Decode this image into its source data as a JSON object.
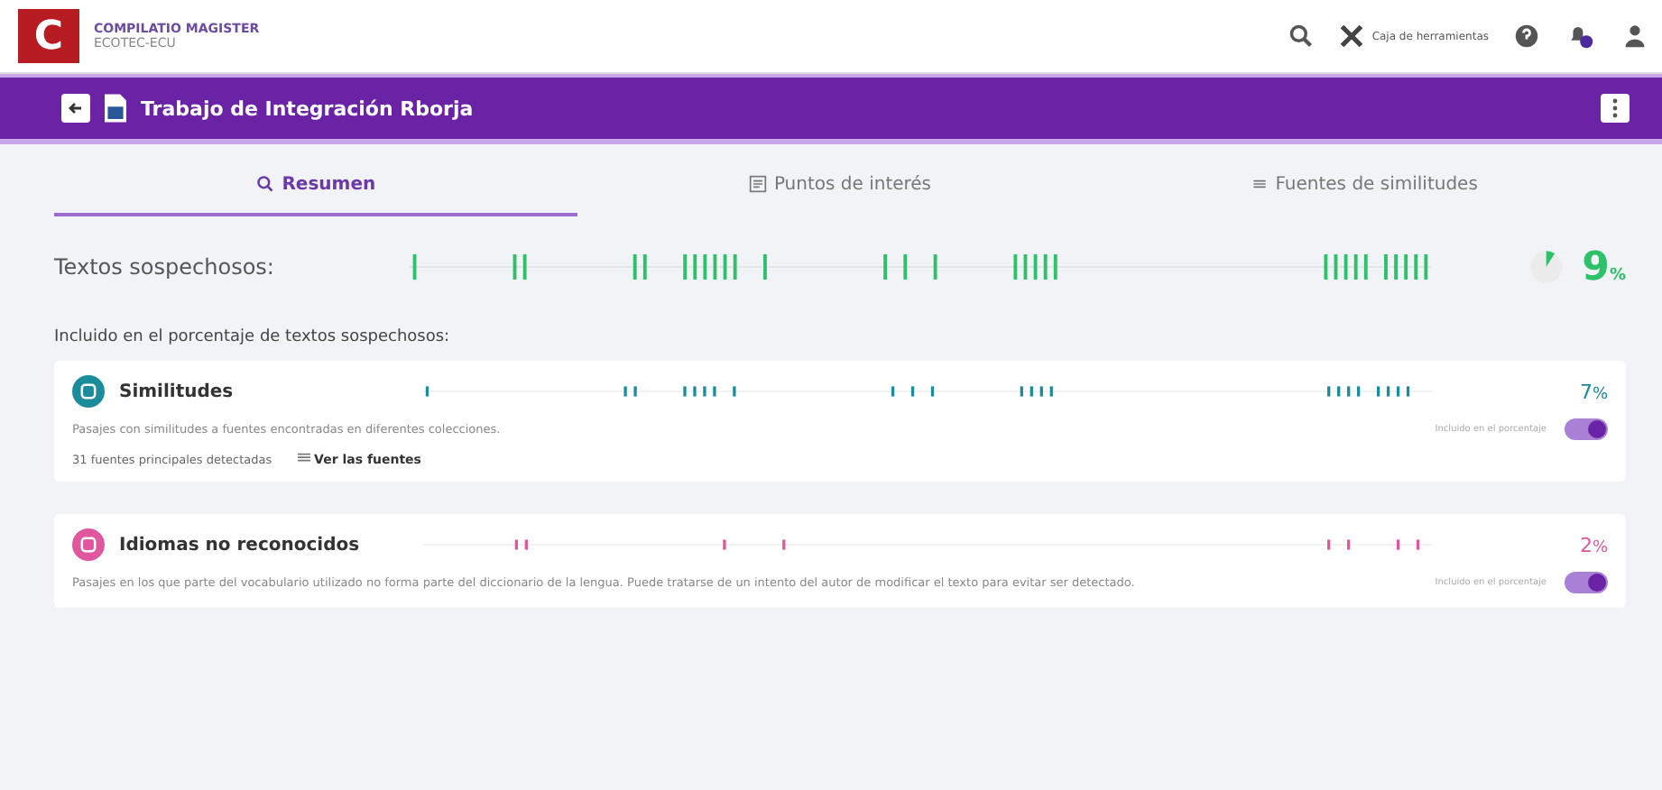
{
  "header": {
    "logo": "C",
    "brand": "COMPILATIO MAGISTER",
    "org": "ECOTEC-ECU",
    "toolbox": "Caja de herramientas"
  },
  "document": {
    "title": "Trabajo de Integración Rborja"
  },
  "tabs": [
    {
      "label": "Resumen",
      "kind": "search",
      "selected": true
    },
    {
      "label": "Puntos de interés",
      "kind": "doc",
      "selected": false
    },
    {
      "label": "Fuentes de similitudes",
      "kind": "list",
      "selected": false
    }
  ],
  "summary": {
    "label": "Textos sospechosos:",
    "value": "9",
    "unit": "%"
  },
  "section_title": "Incluido en el porcentaje de textos sospechosos:",
  "categories": [
    {
      "title": "Similitudes",
      "color": "#1b8c9b",
      "value": "7",
      "unit": "%",
      "description": "Pasajes con similitudes a fuentes encontradas en diferentes colecciones.",
      "toggle_label": "Incluido en el porcentaje",
      "on": true,
      "sources": "31 fuentes principales detectadas",
      "link": "Ver las fuentes"
    },
    {
      "title": "Idiomas no reconocidos",
      "color": "#e0569f",
      "value": "2",
      "unit": "%",
      "description": "Pasajes en los que parte del vocabulario utilizado no forma parte del diccionario de la lengua. Puede tratarse de un intento del autor de modificar el texto para evitar ser detectado.",
      "toggle_label": "Incluido en el porcentaje",
      "on": true
    }
  ]
}
